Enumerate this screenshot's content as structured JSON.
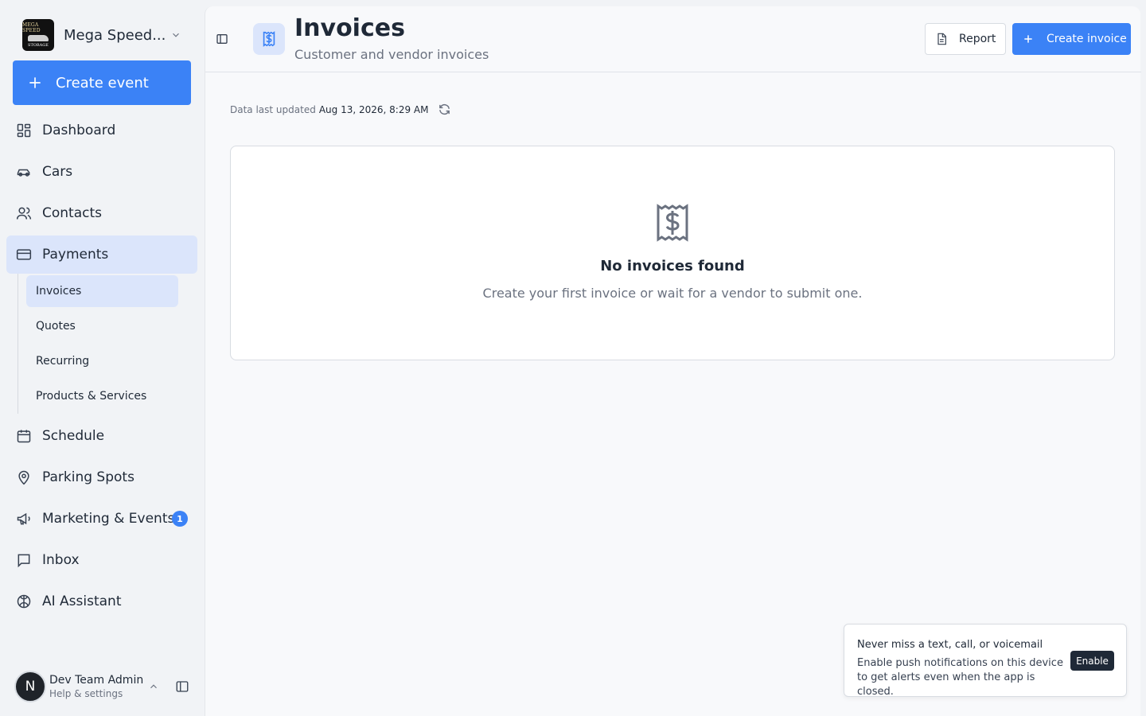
{
  "sidebar": {
    "brand_name": "Mega Speed...",
    "logo_line1": "MEGA SPEED",
    "logo_line2": "STORAGE",
    "create_event_label": "Create event",
    "items": [
      {
        "label": "Dashboard",
        "icon": "dashboard-icon"
      },
      {
        "label": "Cars",
        "icon": "car-icon"
      },
      {
        "label": "Contacts",
        "icon": "users-icon"
      },
      {
        "label": "Payments",
        "icon": "credit-card-icon"
      },
      {
        "label": "Schedule",
        "icon": "calendar-icon"
      },
      {
        "label": "Parking Spots",
        "icon": "map-pin-icon"
      },
      {
        "label": "Marketing & Events",
        "icon": "megaphone-icon",
        "badge": "1"
      },
      {
        "label": "Inbox",
        "icon": "message-icon"
      },
      {
        "label": "AI Assistant",
        "icon": "brain-icon"
      }
    ],
    "payments_sub": [
      "Invoices",
      "Quotes",
      "Recurring",
      "Products & Services"
    ],
    "active_item": "Payments",
    "active_sub": "Invoices",
    "user": {
      "initial": "N",
      "name": "Dev Team Admin",
      "subtitle": "Help & settings"
    }
  },
  "header": {
    "title": "Invoices",
    "subtitle": "Customer and vendor invoices",
    "report_label": "Report",
    "create_invoice_label": "Create invoice"
  },
  "main": {
    "updated_label": "Data last updated",
    "updated_time": "Aug 13, 2026, 8:29 AM",
    "empty_title": "No invoices found",
    "empty_description": "Create your first invoice or wait for a vendor to submit one."
  },
  "toast": {
    "title": "Never miss a text, call, or voicemail",
    "body": "Enable push notifications on this device to get alerts even when the app is closed.",
    "enable_label": "Enable"
  },
  "colors": {
    "accent": "#3b82f6",
    "active_bg": "#dbe5fb",
    "text": "#1f2937",
    "muted": "#6b7280"
  }
}
